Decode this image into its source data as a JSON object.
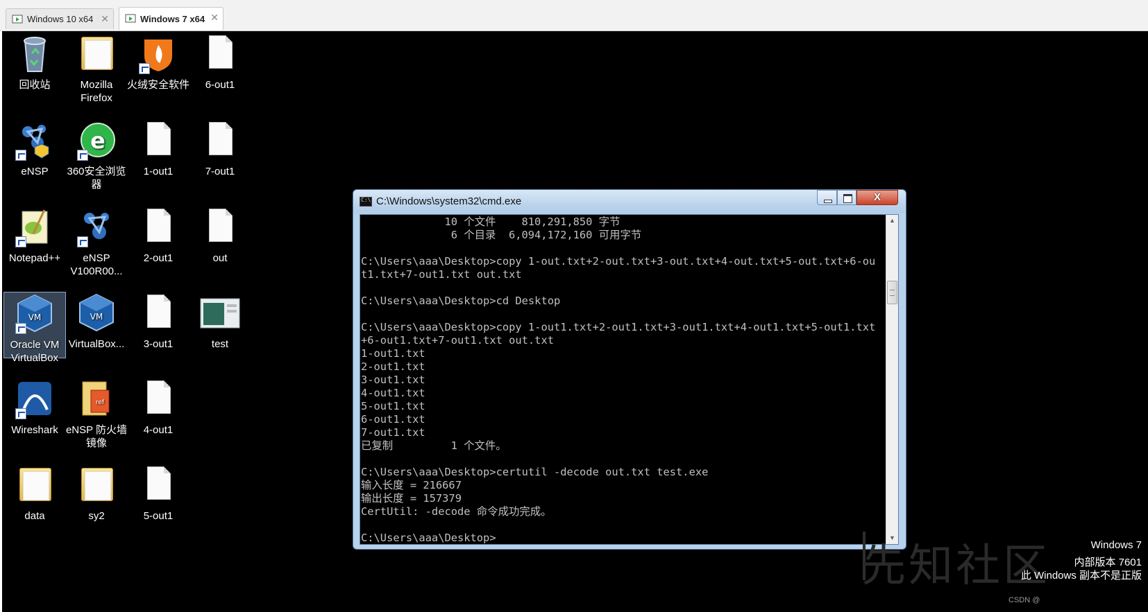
{
  "tabs": [
    {
      "label": "Windows 10 x64",
      "active": false
    },
    {
      "label": "Windows 7 x64",
      "active": true
    }
  ],
  "desktop_icons": [
    {
      "label": "回收站",
      "icon": "recycle-bin-icon"
    },
    {
      "label": "Mozilla Firefox",
      "icon": "folder-icon"
    },
    {
      "label": "火绒安全软件",
      "icon": "huorong-icon"
    },
    {
      "label": "6-out1",
      "icon": "file-icon"
    },
    {
      "label": "eNSP",
      "icon": "ensp-icon"
    },
    {
      "label": "360安全浏览器",
      "icon": "browser-360-icon"
    },
    {
      "label": "1-out1",
      "icon": "file-icon"
    },
    {
      "label": "7-out1",
      "icon": "file-icon"
    },
    {
      "label": "Notepad++",
      "icon": "notepadpp-icon"
    },
    {
      "label": "eNSP V100R00...",
      "icon": "ensp-icon"
    },
    {
      "label": "2-out1",
      "icon": "file-icon"
    },
    {
      "label": "out",
      "icon": "file-icon"
    },
    {
      "label": "Oracle VM VirtualBox",
      "icon": "virtualbox-icon"
    },
    {
      "label": "VirtualBox...",
      "icon": "virtualbox-icon"
    },
    {
      "label": "3-out1",
      "icon": "file-icon"
    },
    {
      "label": "test",
      "icon": "image-file-icon"
    },
    {
      "label": "Wireshark",
      "icon": "wireshark-icon"
    },
    {
      "label": "eNSP 防火墙镜像",
      "icon": "archive-icon"
    },
    {
      "label": "4-out1",
      "icon": "file-icon"
    },
    {
      "label": "data",
      "icon": "folder-icon"
    },
    {
      "label": "sy2",
      "icon": "folder-icon"
    },
    {
      "label": "5-out1",
      "icon": "file-icon"
    }
  ],
  "cmd": {
    "title": "C:\\Windows\\system32\\cmd.exe",
    "close_glyph": "X",
    "lines": [
      "             10 个文件    810,291,850 字节",
      "              6 个目录  6,094,172,160 可用字节",
      "",
      "C:\\Users\\aaa\\Desktop>copy 1-out.txt+2-out.txt+3-out.txt+4-out.txt+5-out.txt+6-ou",
      "t1.txt+7-out1.txt out.txt",
      "",
      "C:\\Users\\aaa\\Desktop>cd Desktop",
      "",
      "C:\\Users\\aaa\\Desktop>copy 1-out1.txt+2-out1.txt+3-out1.txt+4-out1.txt+5-out1.txt",
      "+6-out1.txt+7-out1.txt out.txt",
      "1-out1.txt",
      "2-out1.txt",
      "3-out1.txt",
      "4-out1.txt",
      "5-out1.txt",
      "6-out1.txt",
      "7-out1.txt",
      "已复制         1 个文件。",
      "",
      "C:\\Users\\aaa\\Desktop>certutil -decode out.txt test.exe",
      "输入长度 = 216667",
      "输出长度 = 157379",
      "CertUtil: -decode 命令成功完成。",
      "",
      "C:\\Users\\aaa\\Desktop>"
    ]
  },
  "watermark": "先知社区",
  "windows_info": [
    "Windows 7",
    "内部版本 7601",
    "此 Windows 副本不是正版"
  ],
  "csdn_mark": "CSDN @"
}
